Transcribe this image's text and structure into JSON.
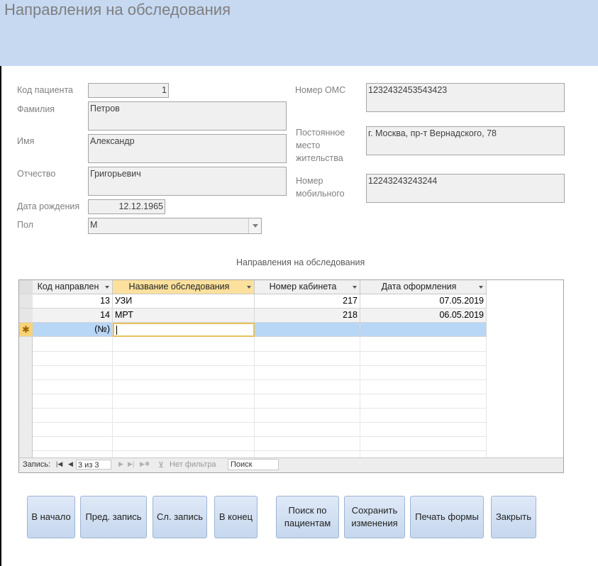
{
  "header": {
    "title": "Направления на обследования"
  },
  "form": {
    "patient_id": {
      "label": "Код пациента",
      "value": "1"
    },
    "last_name": {
      "label": "Фамилия",
      "value": "Петров"
    },
    "first_name": {
      "label": "Имя",
      "value": "Александр"
    },
    "patronymic": {
      "label": "Отчество",
      "value": "Григорьевич"
    },
    "birth_date": {
      "label": "Дата рождения",
      "value": "12.12.1965"
    },
    "gender": {
      "label": "Пол",
      "value": "М"
    },
    "oms": {
      "label": "Номер ОМС",
      "value": "1232432453543423"
    },
    "address": {
      "label_l1": "Постоянное",
      "label_l2": "место",
      "label_l3": "жительства",
      "value": "г. Москва, пр-т Вернадского, 78"
    },
    "mobile": {
      "label_l1": "Номер",
      "label_l2": "мобильного",
      "value": "12243243243244"
    }
  },
  "subform": {
    "caption": "Направления на обследования",
    "columns": [
      "Код направлен",
      "Название обследования",
      "Номер кабинета",
      "Дата оформления"
    ],
    "rows": [
      {
        "id": "13",
        "name": "УЗИ",
        "room": "217",
        "date": "07.05.2019"
      },
      {
        "id": "14",
        "name": "МРТ",
        "room": "218",
        "date": "06.05.2019"
      }
    ],
    "new_row": {
      "marker": "✱",
      "id": "(№)"
    },
    "nav": {
      "label": "Запись:",
      "position": "3 из 3",
      "filter": "Нет фильтра",
      "search": "Поиск"
    }
  },
  "buttons": {
    "first": "В начало",
    "prev": "Пред. запись",
    "next": "Сл. запись",
    "last": "В конец",
    "search_l1": "Поиск по",
    "search_l2": "пациентам",
    "save_l1": "Сохранить",
    "save_l2": "изменения",
    "print": "Печать формы",
    "close": "Закрыть"
  }
}
